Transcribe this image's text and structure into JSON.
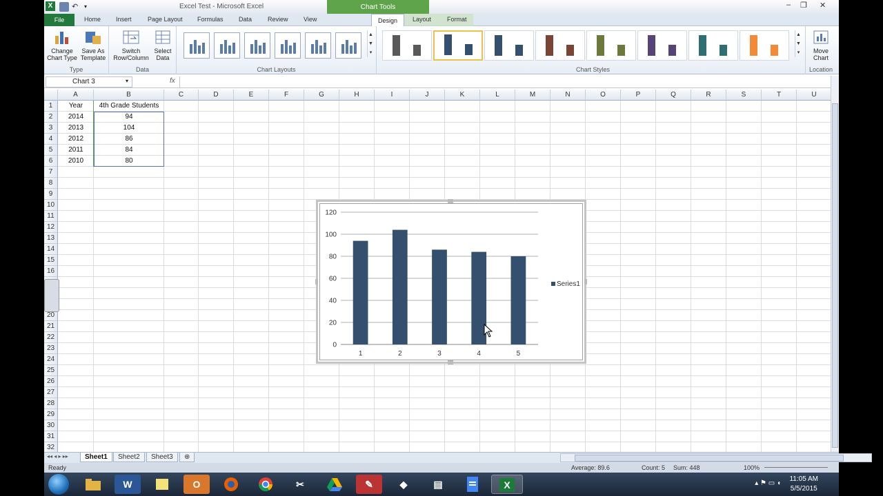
{
  "window": {
    "title": "Excel Test - Microsoft Excel",
    "context_tab_group": "Chart Tools",
    "minimize": "–",
    "restore": "❐",
    "close": "✕"
  },
  "tabs": [
    {
      "label": "File"
    },
    {
      "label": "Home"
    },
    {
      "label": "Insert"
    },
    {
      "label": "Page Layout"
    },
    {
      "label": "Formulas"
    },
    {
      "label": "Data"
    },
    {
      "label": "Review"
    },
    {
      "label": "View"
    },
    {
      "label": "Design"
    },
    {
      "label": "Layout"
    },
    {
      "label": "Format"
    }
  ],
  "ribbon": {
    "type_group": {
      "label": "Type",
      "change_chart_type": "Change Chart Type",
      "save_as_template": "Save As Template"
    },
    "data_group": {
      "label": "Data",
      "switch_row_column": "Switch Row/Column",
      "select_data": "Select Data"
    },
    "layouts_group": {
      "label": "Chart Layouts"
    },
    "styles_group": {
      "label": "Chart Styles",
      "style_colors": [
        "#595959",
        "#34506e",
        "#34506e",
        "#7a4535",
        "#6b7a3a",
        "#574476",
        "#2f6e73",
        "#f28a37"
      ]
    },
    "location_group": {
      "label": "Location",
      "move_chart": "Move Chart"
    }
  },
  "formula_bar": {
    "name_box": "Chart 3",
    "fx_label": "fx",
    "content": ""
  },
  "columns": [
    "A",
    "B",
    "C",
    "D",
    "E",
    "F",
    "G",
    "H",
    "I",
    "J",
    "K",
    "L",
    "M",
    "N",
    "O",
    "P",
    "Q",
    "R",
    "S",
    "T",
    "U"
  ],
  "rows": [
    "1",
    "2",
    "3",
    "4",
    "5",
    "6",
    "7",
    "8",
    "9",
    "10",
    "11",
    "12",
    "13",
    "14",
    "15",
    "16",
    "17",
    "18",
    "19",
    "20",
    "21",
    "22",
    "23",
    "24",
    "25",
    "26",
    "27",
    "28",
    "29",
    "30",
    "31",
    "32"
  ],
  "cells": {
    "headers": [
      "Year",
      "4th Grade Students"
    ],
    "data": [
      [
        "2014",
        "94"
      ],
      [
        "2013",
        "104"
      ],
      [
        "2012",
        "86"
      ],
      [
        "2011",
        "84"
      ],
      [
        "2010",
        "80"
      ]
    ]
  },
  "chart_data": {
    "type": "bar",
    "categories": [
      "1",
      "2",
      "3",
      "4",
      "5"
    ],
    "series": [
      {
        "name": "Series1",
        "values": [
          94,
          104,
          86,
          84,
          80
        ],
        "color": "#34506e"
      }
    ],
    "ylim": [
      0,
      120
    ],
    "yticks": [
      0,
      20,
      40,
      60,
      80,
      100,
      120
    ],
    "grid": true,
    "legend": "right"
  },
  "sheets": {
    "tabs": [
      "Sheet1",
      "Sheet2",
      "Sheet3"
    ],
    "active": "Sheet1"
  },
  "status": {
    "ready": "Ready",
    "average": "Average: 89.6",
    "count": "Count: 5",
    "sum": "Sum: 448",
    "zoom": "100%"
  },
  "taskbar": {
    "time": "11:05 AM",
    "date": "5/5/2015"
  }
}
